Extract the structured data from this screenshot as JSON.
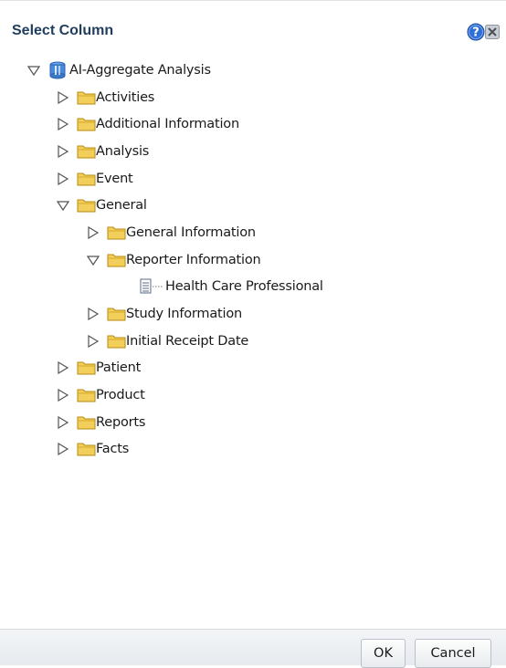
{
  "dialog": {
    "title": "Select Column",
    "help_icon": "help-icon",
    "close_icon": "close-icon"
  },
  "tree": {
    "root": {
      "label": "AI-Aggregate Analysis",
      "expanded": true,
      "icon": "subject-area-icon"
    },
    "items": [
      {
        "label": "Activities",
        "expanded": false,
        "icon": "folder-icon"
      },
      {
        "label": "Additional Information",
        "expanded": false,
        "icon": "folder-icon"
      },
      {
        "label": "Analysis",
        "expanded": false,
        "icon": "folder-icon"
      },
      {
        "label": "Event",
        "expanded": false,
        "icon": "folder-icon"
      },
      {
        "label": "General",
        "expanded": true,
        "icon": "folder-icon"
      },
      {
        "label": "General Information",
        "expanded": false,
        "icon": "folder-icon"
      },
      {
        "label": "Reporter Information",
        "expanded": true,
        "icon": "folder-icon"
      },
      {
        "label": "Health Care Professional",
        "icon": "column-icon"
      },
      {
        "label": "Study Information",
        "expanded": false,
        "icon": "folder-icon"
      },
      {
        "label": "Initial Receipt Date",
        "expanded": false,
        "icon": "folder-icon"
      },
      {
        "label": "Patient",
        "expanded": false,
        "icon": "folder-icon"
      },
      {
        "label": "Product",
        "expanded": false,
        "icon": "folder-icon"
      },
      {
        "label": "Reports",
        "expanded": false,
        "icon": "folder-icon"
      },
      {
        "label": "Facts",
        "expanded": false,
        "icon": "folder-icon"
      }
    ]
  },
  "footer": {
    "ok_label": "OK",
    "cancel_label": "Cancel"
  },
  "colors": {
    "title": "#1f3d5c",
    "folder_fill": "#f2cf5b",
    "folder_border": "#b88a12",
    "help_blue": "#2f6fd6"
  }
}
